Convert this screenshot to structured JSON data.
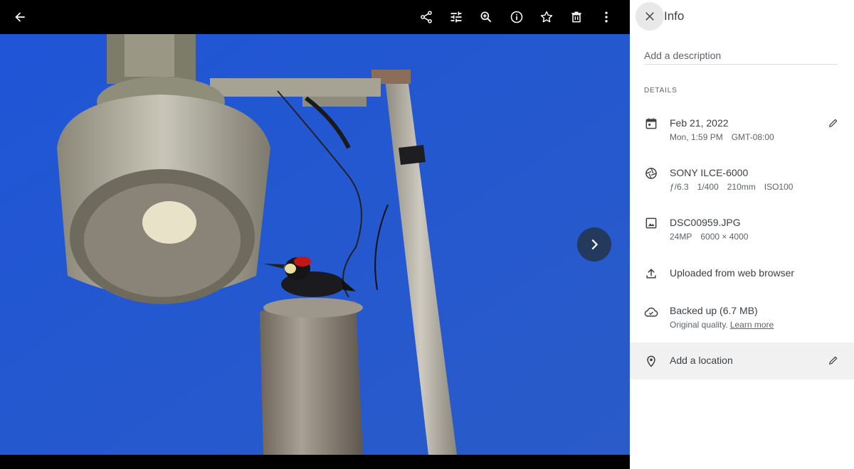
{
  "toolbar": {
    "icons": [
      "back-arrow-icon",
      "share-icon",
      "edit-tune-icon",
      "zoom-in-icon",
      "info-icon",
      "star-icon",
      "delete-icon",
      "more-vert-icon"
    ]
  },
  "viewer": {
    "next_icon": "chevron-right-icon",
    "photo_colors": {
      "sky": "#2a5bd0",
      "pole": "#b8b3a8"
    }
  },
  "info": {
    "title": "Info",
    "description_placeholder": "Add a description",
    "details_heading": "DETAILS",
    "date": {
      "primary": "Feb 21, 2022",
      "day_time": "Mon, 1:59 PM",
      "timezone": "GMT-08:00"
    },
    "camera": {
      "model": "SONY ILCE-6000",
      "aperture": "ƒ/6.3",
      "shutter": "1/400",
      "focal": "210mm",
      "iso": "ISO100"
    },
    "file": {
      "name": "DSC00959.JPG",
      "megapixels": "24MP",
      "resolution": "6000 × 4000"
    },
    "upload": {
      "text": "Uploaded from web browser"
    },
    "backup": {
      "text": "Backed up (6.7 MB)",
      "quality": "Original quality.",
      "learn_more": "Learn more"
    },
    "location": {
      "text": "Add a location"
    }
  },
  "colors": {
    "accent": "#1a73e8",
    "panel_bg": "#ffffff",
    "icon": "#3c4043"
  }
}
